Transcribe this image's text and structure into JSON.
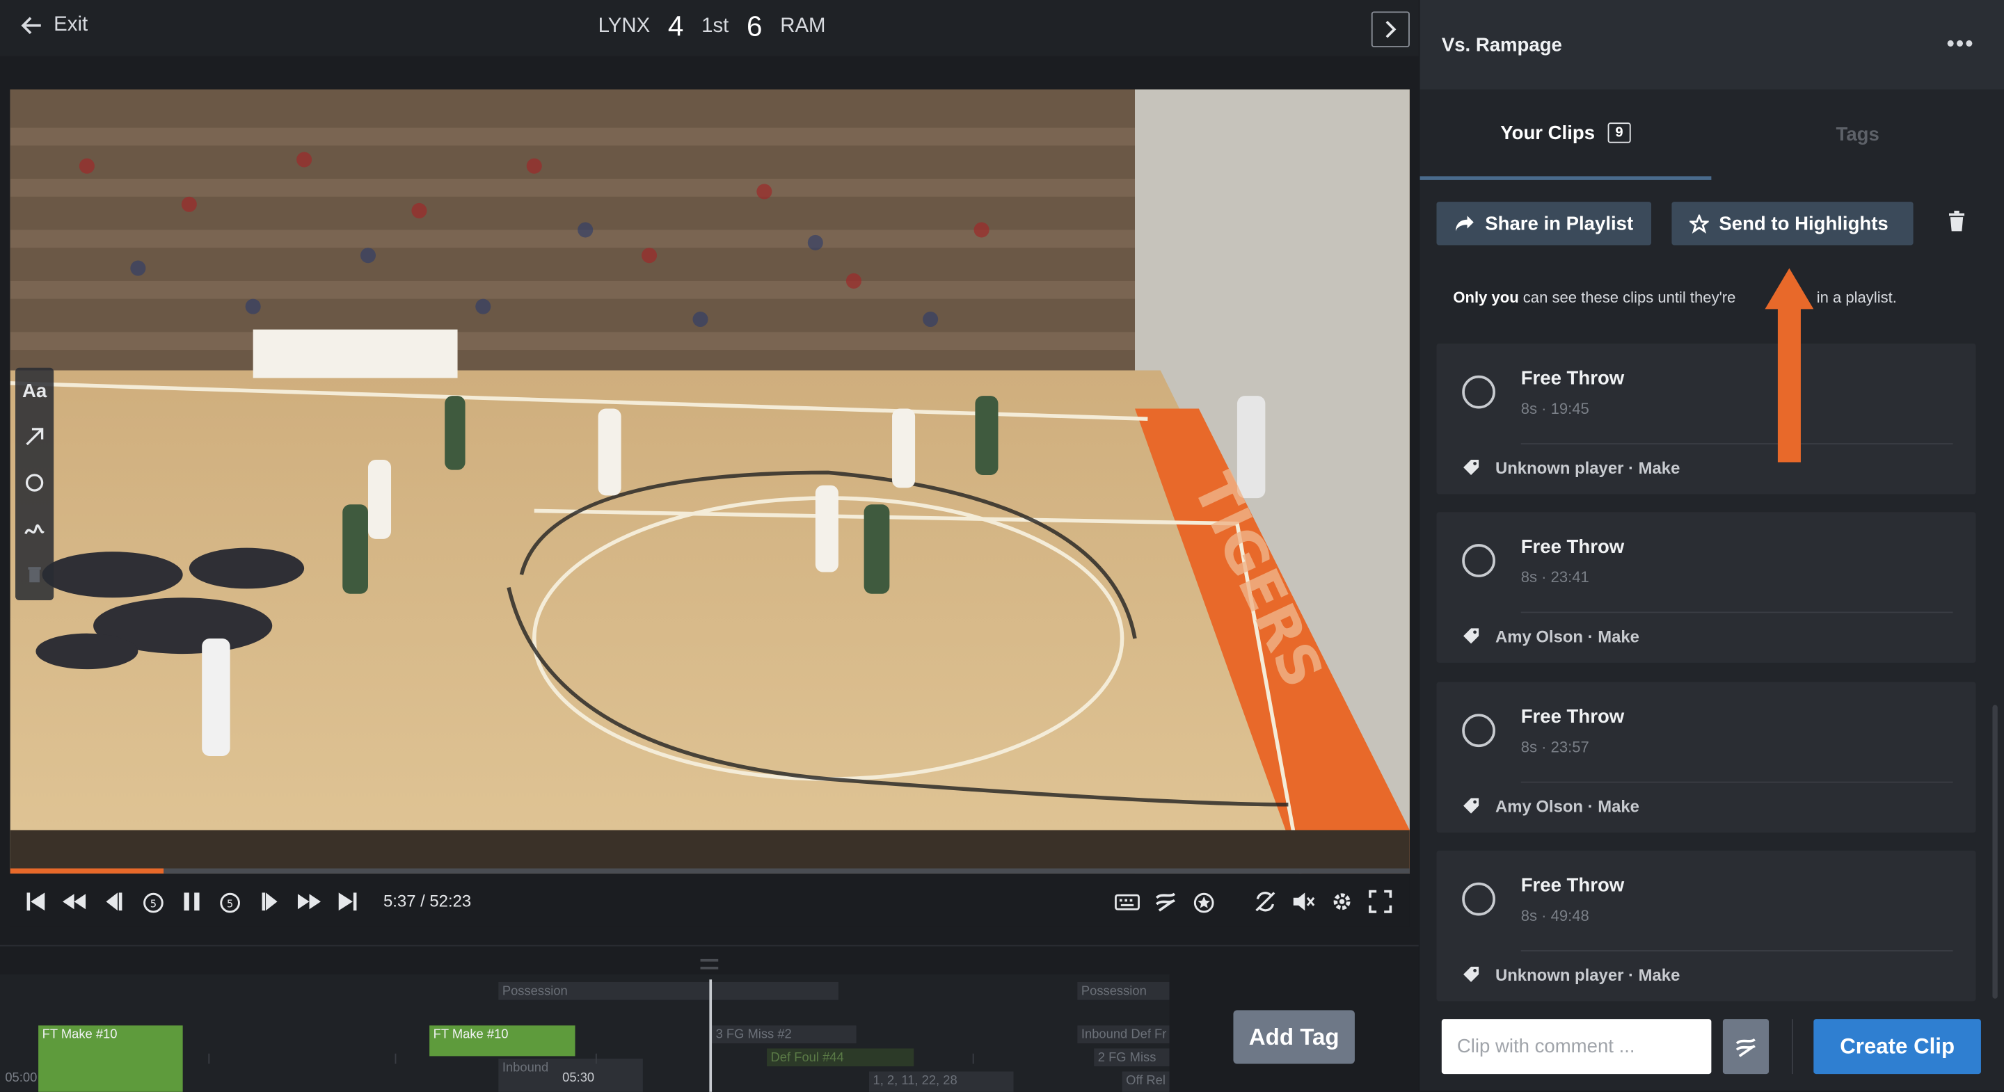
{
  "topbar": {
    "exit_label": "Exit",
    "home_team": "LYNX",
    "home_score": "4",
    "period": "1st",
    "away_score": "6",
    "away_team": "RAM"
  },
  "player": {
    "time_readout": "5:37 / 52:23",
    "progress": 0.11,
    "draw_tool_text": "Aa"
  },
  "timeline": {
    "segments": [
      {
        "label": "FT Make #10"
      },
      {
        "label": "FT Make #10"
      },
      {
        "label": "Possession"
      },
      {
        "label": "Possession"
      },
      {
        "label": "3 FG Miss #2"
      },
      {
        "label": "Def Foul #44"
      },
      {
        "label": "Inbound"
      },
      {
        "label": "1, 2, 11, 22, 28"
      },
      {
        "label": "Inbound Def Fr"
      },
      {
        "label": "2 FG Miss"
      },
      {
        "label": "Off Rel"
      }
    ],
    "start_label": "05:00",
    "mid_label": "05:30",
    "add_tag_label": "Add Tag"
  },
  "sidebar": {
    "title": "Vs. Rampage",
    "more_label": "•••",
    "tabs": {
      "clips_label": "Your Clips",
      "clips_count": "9",
      "tags_label": "Tags"
    },
    "share_label": "Share in Playlist",
    "highlights_label": "Send to Highlights",
    "notice_strong": "Only you",
    "notice_rest": " can see these clips until they're",
    "notice_tail": "in a playlist.",
    "clips": [
      {
        "title": "Free Throw",
        "meta": "8s · 19:45",
        "tag": "Unknown player · Make"
      },
      {
        "title": "Free Throw",
        "meta": "8s · 23:41",
        "tag": "Amy Olson · Make"
      },
      {
        "title": "Free Throw",
        "meta": "8s · 23:57",
        "tag": "Amy Olson · Make"
      },
      {
        "title": "Free Throw",
        "meta": "8s · 49:48",
        "tag": "Unknown player · Make"
      }
    ],
    "comment_placeholder": "Clip with comment ...",
    "create_clip_label": "Create Clip"
  },
  "colors": {
    "accent_orange": "#e8692a",
    "primary_blue": "#2f7fd1",
    "tag_green": "#5e9b3c",
    "button_slate": "#3b4a5a"
  }
}
